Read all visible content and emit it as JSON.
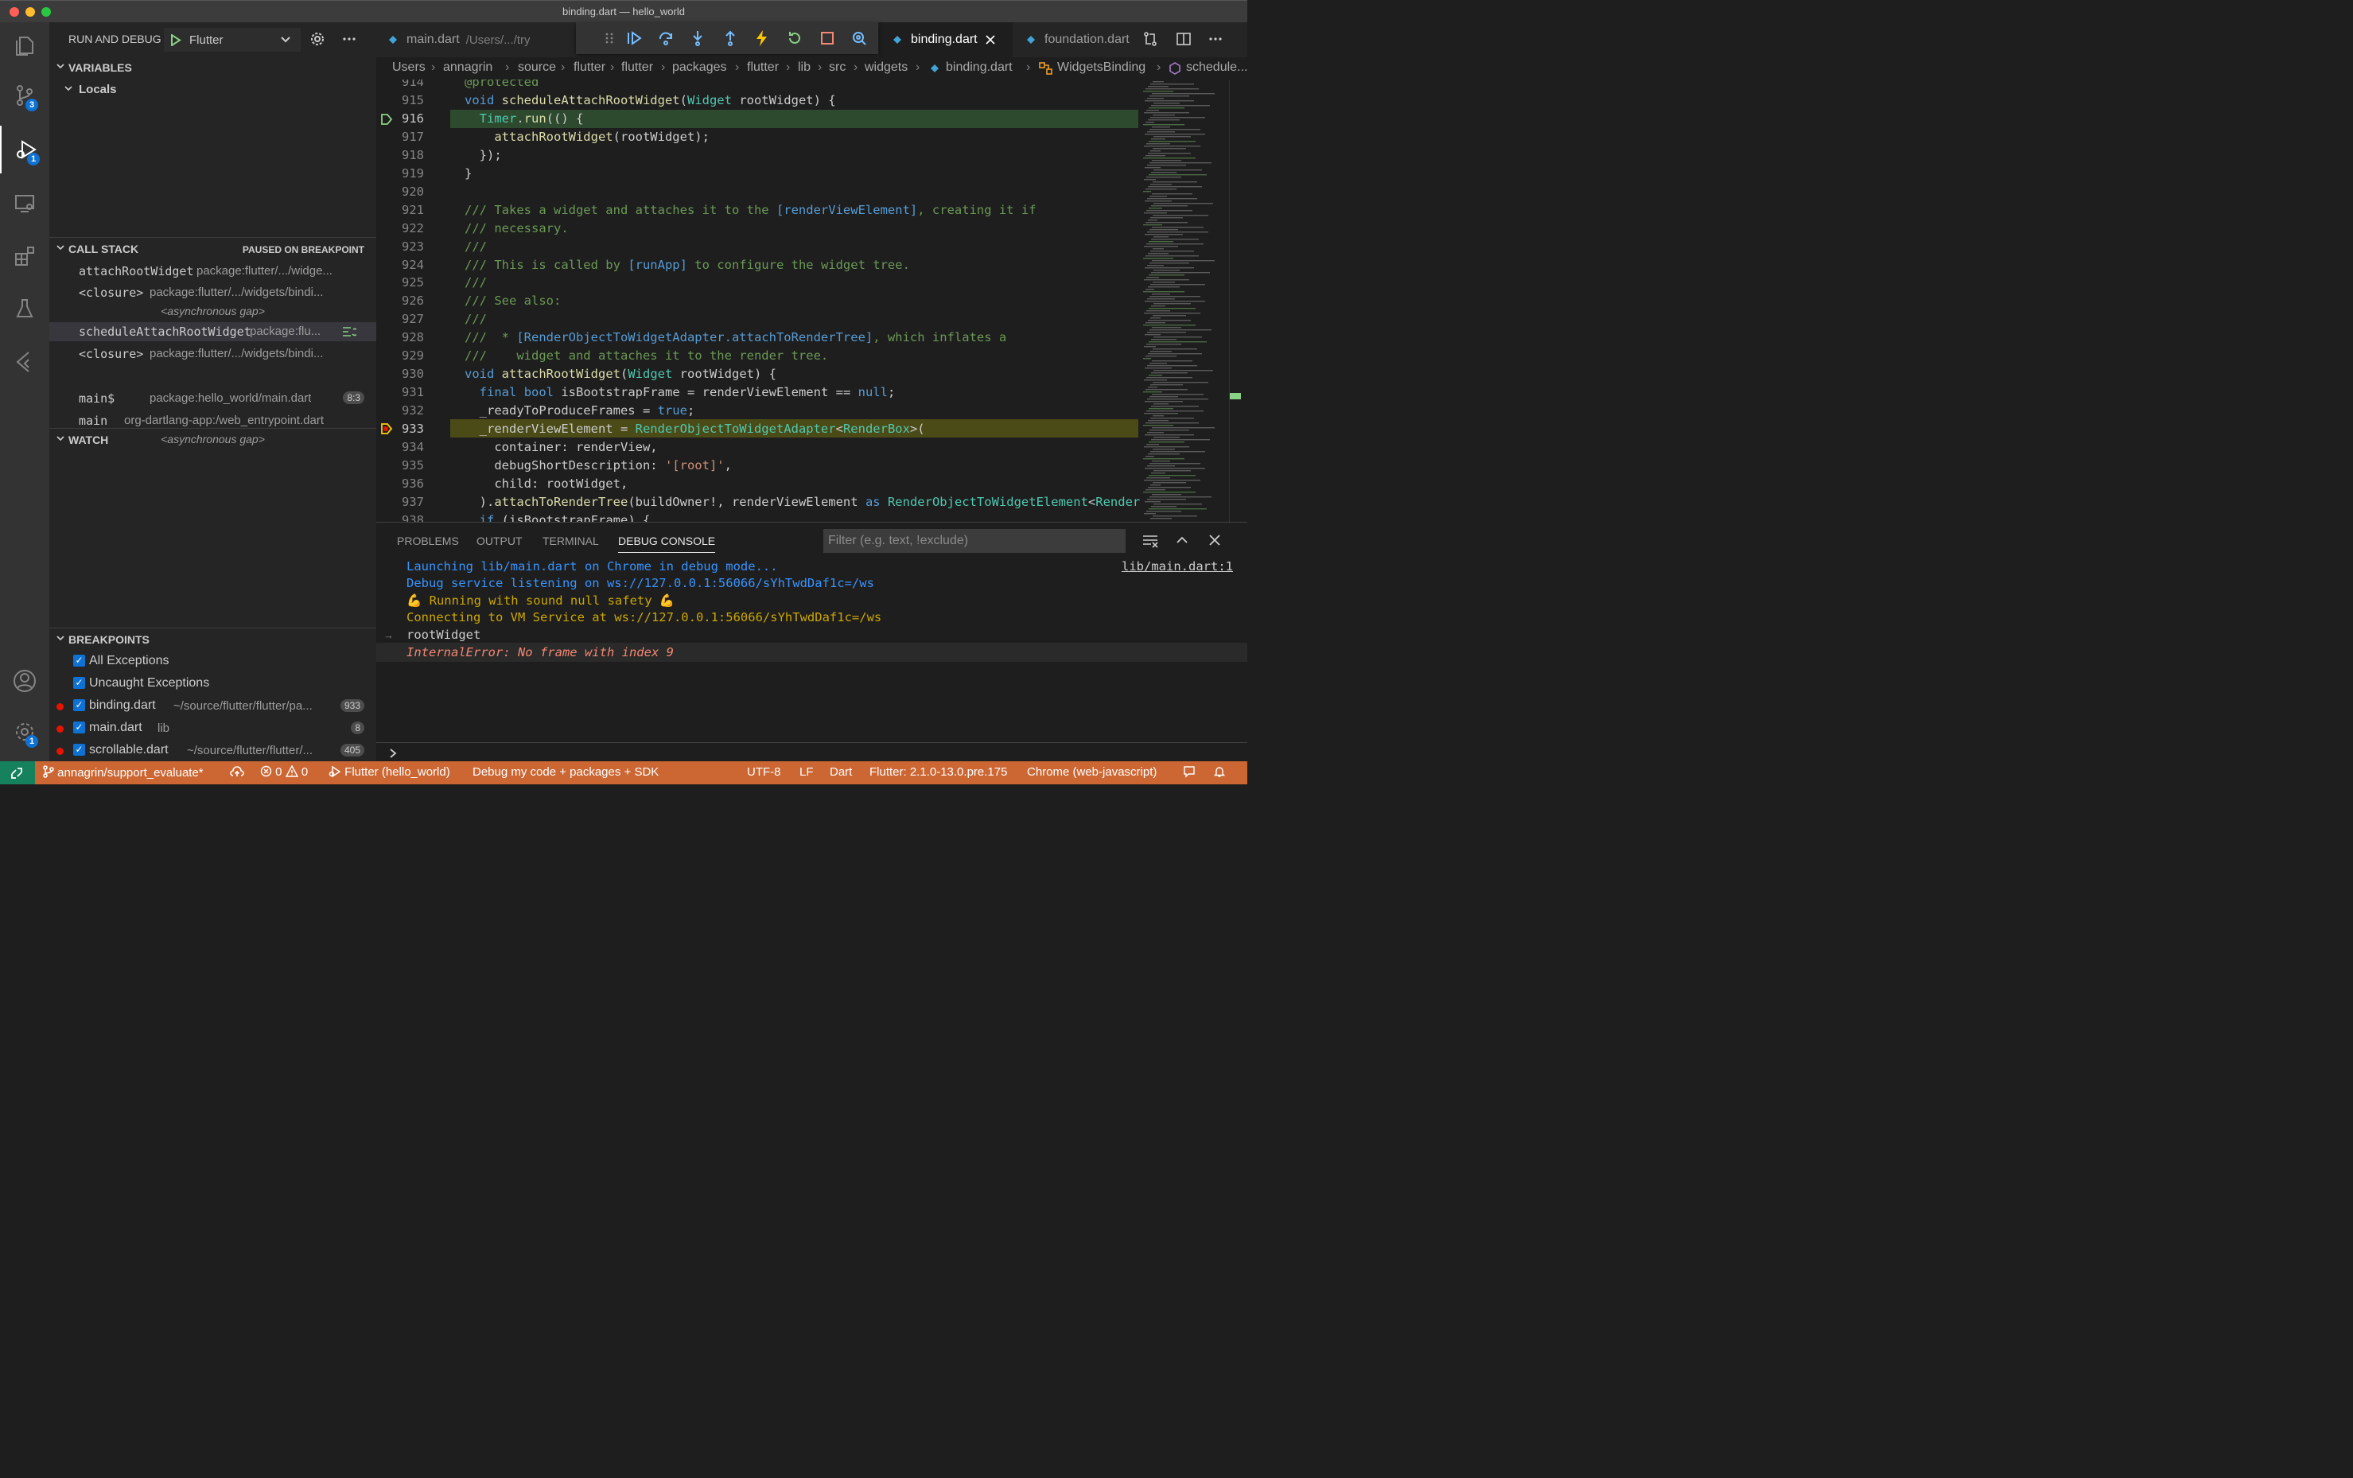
{
  "window": {
    "title": "binding.dart — hello_world"
  },
  "activity_bar": {
    "source_control_badge": "3",
    "debug_badge": "1",
    "settings_badge": "1"
  },
  "sidebar": {
    "header": "RUN AND DEBUG",
    "config": "Flutter",
    "variables": {
      "title": "VARIABLES",
      "locals": "Locals"
    },
    "call_stack": {
      "title": "CALL STACK",
      "status": "PAUSED ON BREAKPOINT",
      "frames": [
        {
          "fn": "attachRootWidget",
          "src": "package:flutter/.../widge..."
        },
        {
          "fn": "<closure>",
          "src": "package:flutter/.../widgets/bindi..."
        },
        {
          "gap": "<asynchronous gap>"
        },
        {
          "fn": "scheduleAttachRootWidget",
          "src": "package:flu..."
        },
        {
          "fn": "<closure>",
          "src": "package:flutter/.../widgets/bindi..."
        },
        {
          "fn": "main$",
          "src": "package:hello_world/main.dart",
          "badge": "8:3"
        },
        {
          "fn": "main",
          "src": "org-dartlang-app:/web_entrypoint.dart"
        },
        {
          "gap": "<asynchronous gap>"
        }
      ]
    },
    "watch": {
      "title": "WATCH"
    },
    "breakpoints": {
      "title": "BREAKPOINTS",
      "items": [
        {
          "name": "All Exceptions",
          "path": "",
          "count": ""
        },
        {
          "name": "Uncaught Exceptions",
          "path": "",
          "count": ""
        },
        {
          "name": "binding.dart",
          "path": "~/source/flutter/flutter/pa...",
          "count": "933"
        },
        {
          "name": "main.dart",
          "path": "lib",
          "count": "8"
        },
        {
          "name": "scrollable.dart",
          "path": "~/source/flutter/flutter/...",
          "count": "405"
        }
      ]
    }
  },
  "tabs": [
    {
      "name": "main.dart",
      "desc": "/Users/.../try"
    },
    {
      "name": "binding.dart",
      "desc": ""
    },
    {
      "name": "foundation.dart",
      "desc": ""
    }
  ],
  "breadcrumb": [
    "Users",
    "annagrin",
    "source",
    "flutter",
    "flutter",
    "packages",
    "flutter",
    "lib",
    "src",
    "widgets",
    "binding.dart",
    "WidgetsBinding",
    "schedule..."
  ],
  "editor": {
    "lines": [
      {
        "n": "914",
        "html": "<span class=\"cm\">@protected</span>"
      },
      {
        "n": "915",
        "html": "<span class=\"kw\">void</span> <span class=\"fn2\">scheduleAttachRootWidget</span>(<span class=\"ty\">Widget</span> rootWidget) {"
      },
      {
        "n": "916",
        "html": "  <span class=\"ty\">Timer</span>.<span class=\"fn2\">run</span>(() {"
      },
      {
        "n": "917",
        "html": "    <span class=\"fn2\">attachRootWidget</span>(rootWidget);"
      },
      {
        "n": "918",
        "html": "  });"
      },
      {
        "n": "919",
        "html": "}"
      },
      {
        "n": "920",
        "html": ""
      },
      {
        "n": "921",
        "html": "<span class=\"cm\">/// Takes a widget and attaches it to the </span><span class=\"br\">[renderViewElement]</span><span class=\"cm\">, creating it if</span>"
      },
      {
        "n": "922",
        "html": "<span class=\"cm\">/// necessary.</span>"
      },
      {
        "n": "923",
        "html": "<span class=\"cm\">///</span>"
      },
      {
        "n": "924",
        "html": "<span class=\"cm\">/// This is called by </span><span class=\"br\">[runApp]</span><span class=\"cm\"> to configure the widget tree.</span>"
      },
      {
        "n": "925",
        "html": "<span class=\"cm\">///</span>"
      },
      {
        "n": "926",
        "html": "<span class=\"cm\">/// See also:</span>"
      },
      {
        "n": "927",
        "html": "<span class=\"cm\">///</span>"
      },
      {
        "n": "928",
        "html": "<span class=\"cm\">///  * </span><span class=\"br\">[RenderObjectToWidgetAdapter.attachToRenderTree]</span><span class=\"cm\">, which inflates a</span>"
      },
      {
        "n": "929",
        "html": "<span class=\"cm\">///    widget and attaches it to the render tree.</span>"
      },
      {
        "n": "930",
        "html": "<span class=\"kw\">void</span> <span class=\"fn2\">attachRootWidget</span>(<span class=\"ty\">Widget</span> rootWidget) {"
      },
      {
        "n": "931",
        "html": "  <span class=\"kw\">final</span> <span class=\"kw\">bool</span> isBootstrapFrame = renderViewElement == <span class=\"kw\">null</span>;"
      },
      {
        "n": "932",
        "html": "  _readyToProduceFrames = <span class=\"kw\">true</span>;"
      },
      {
        "n": "933",
        "html": "  _renderViewElement = <span class=\"ty\">RenderObjectToWidgetAdapter</span>&lt;<span class=\"ty\">RenderBox</span>&gt;("
      },
      {
        "n": "934",
        "html": "    container: renderView,"
      },
      {
        "n": "935",
        "html": "    debugShortDescription: <span class=\"str\">'[root]'</span>,"
      },
      {
        "n": "936",
        "html": "    child: rootWidget,"
      },
      {
        "n": "937",
        "html": "  ).<span class=\"fn2\">attachToRenderTree</span>(buildOwner!, renderViewElement <span class=\"kw\">as</span> <span class=\"ty\">RenderObjectToWidgetElement</span>&lt;<span class=\"ty\">RenderB</span>"
      },
      {
        "n": "938",
        "html": "  <span class=\"kw\">if</span> (isBootstrapFrame) {"
      }
    ]
  },
  "panel": {
    "tabs": [
      "PROBLEMS",
      "OUTPUT",
      "TERMINAL",
      "DEBUG CONSOLE"
    ],
    "filter_placeholder": "Filter (e.g. text, !exclude)",
    "source_link": "lib/main.dart:1",
    "console": [
      {
        "text": "Launching lib/main.dart on Chrome in debug mode...",
        "kind": "c-blue"
      },
      {
        "text": "Debug service listening on ws://127.0.0.1:56066/sYhTwdDaf1c=/ws",
        "kind": "c-blue"
      },
      {
        "text": "💪 Running with sound null safety 💪",
        "kind": "c-yellow"
      },
      {
        "text": "Connecting to VM Service at ws://127.0.0.1:56066/sYhTwdDaf1c=/ws",
        "kind": "c-yellow"
      },
      {
        "text": "rootWidget",
        "kind": "c-white"
      },
      {
        "text": "InternalError: No frame with index 9",
        "kind": "c-red"
      }
    ]
  },
  "statusbar": {
    "branch": "annagrin/support_evaluate*",
    "errors": "0",
    "warnings": "0",
    "launch": "Flutter (hello_world)",
    "debug_mode": "Debug my code + packages + SDK",
    "encoding": "UTF-8",
    "eol": "LF",
    "language": "Dart",
    "flutter_version": "Flutter: 2.1.0-13.0.pre.175",
    "device": "Chrome (web-javascript)"
  },
  "colors": {
    "statusbar": "#cc6633",
    "remote": "#16825d",
    "accent": "#0e72d4"
  }
}
